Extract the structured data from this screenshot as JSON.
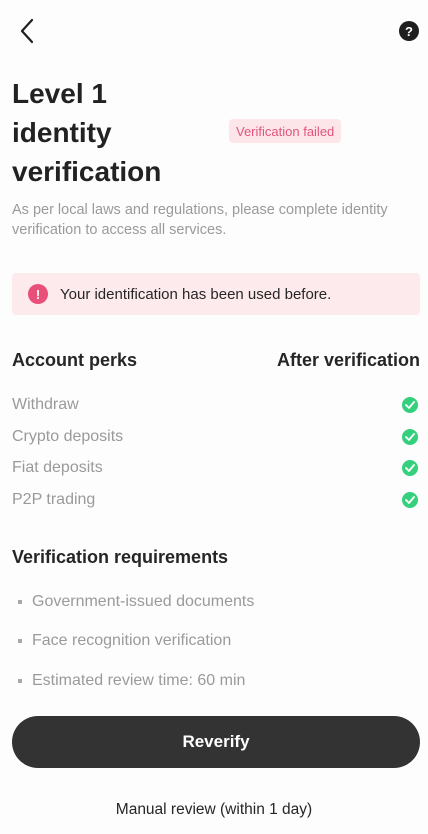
{
  "header": {
    "back_icon": "chevron-left-icon",
    "help_icon": "question-circle-icon",
    "help_glyph": "?"
  },
  "title": "Level 1 identity verification",
  "status_badge": "Verification failed",
  "subtitle": "As per local laws and regulations, please complete identity verification to access all services.",
  "alert": {
    "icon": "exclamation-circle-icon",
    "glyph": "!",
    "text": "Your identification has been used before."
  },
  "perks": {
    "left_header": "Account perks",
    "right_header": "After verification",
    "items": [
      {
        "label": "Withdraw",
        "enabled": true
      },
      {
        "label": "Crypto deposits",
        "enabled": true
      },
      {
        "label": "Fiat deposits",
        "enabled": true
      },
      {
        "label": "P2P trading",
        "enabled": true
      }
    ]
  },
  "requirements": {
    "title": "Verification requirements",
    "items": [
      "Government-issued documents",
      "Face recognition verification",
      "Estimated review time: 60 min"
    ]
  },
  "actions": {
    "reverify_label": "Reverify",
    "manual_review_label": "Manual review (within 1 day)"
  },
  "colors": {
    "primary_button": "#333333",
    "badge_bg": "#fde6ea",
    "badge_text": "#e2557a",
    "alert_icon": "#e8507a",
    "check": "#34d07d"
  }
}
